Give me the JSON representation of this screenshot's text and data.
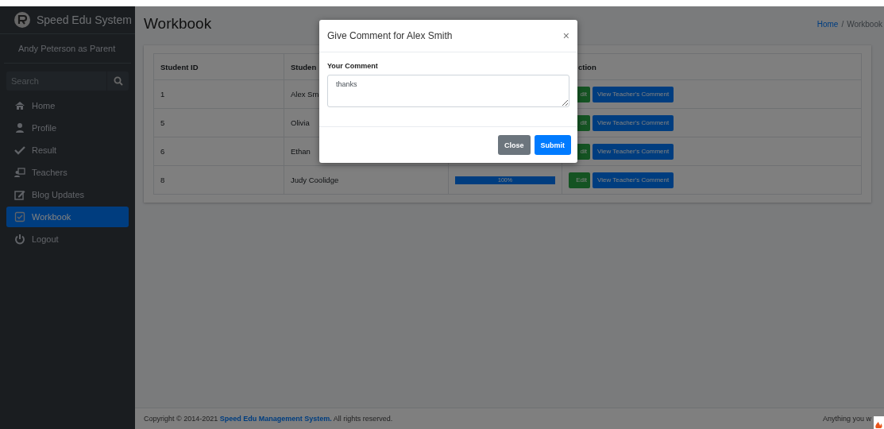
{
  "sidebar": {
    "brand": "Speed Edu System",
    "user": "Andy Peterson as Parent",
    "search": {
      "placeholder": "Search"
    },
    "items": [
      {
        "label": "Home",
        "selected": false
      },
      {
        "label": "Profile",
        "selected": false
      },
      {
        "label": "Result",
        "selected": false
      },
      {
        "label": "Teachers",
        "selected": false
      },
      {
        "label": "Blog Updates",
        "selected": false
      },
      {
        "label": "Workbook",
        "selected": true
      },
      {
        "label": "Logout",
        "selected": false
      }
    ]
  },
  "header": {
    "title": "Workbook",
    "separator": "/",
    "breadcrumbs": [
      {
        "label": "Home",
        "kind": "link"
      },
      {
        "label": "Workbook",
        "kind": "current"
      }
    ]
  },
  "table": {
    "columns": [
      "Student ID",
      "Studen",
      "",
      "ction"
    ],
    "rows": [
      {
        "id": "1",
        "name": "Alex Sm",
        "actions": [
          "dit",
          "View Teacher's Comment"
        ]
      },
      {
        "id": "5",
        "name": "Olivia",
        "actions": [
          "dit",
          "View Teacher's Comment"
        ]
      },
      {
        "id": "6",
        "name": "Ethan",
        "actions": [
          "dit",
          "View Teacher's Comment"
        ]
      },
      {
        "id": "8",
        "name": "Judy Coolidge",
        "progress": {
          "level": 1,
          "label": "100%"
        },
        "actions": [
          "Edit",
          "View Teacher's Comment"
        ]
      }
    ]
  },
  "footer": {
    "text": "Copyright © 2014-2021 **Speed Edu Management System.** All rights reserved.",
    "right": "Anything you w"
  },
  "modal": {
    "title": "Give Comment for Alex Smith",
    "close_glyph": "×",
    "label": "Your Comment",
    "value": "thanks",
    "buttons": [
      {
        "label": "Close",
        "kind": "secondary"
      },
      {
        "label": "Submit",
        "kind": "primary"
      }
    ]
  }
}
